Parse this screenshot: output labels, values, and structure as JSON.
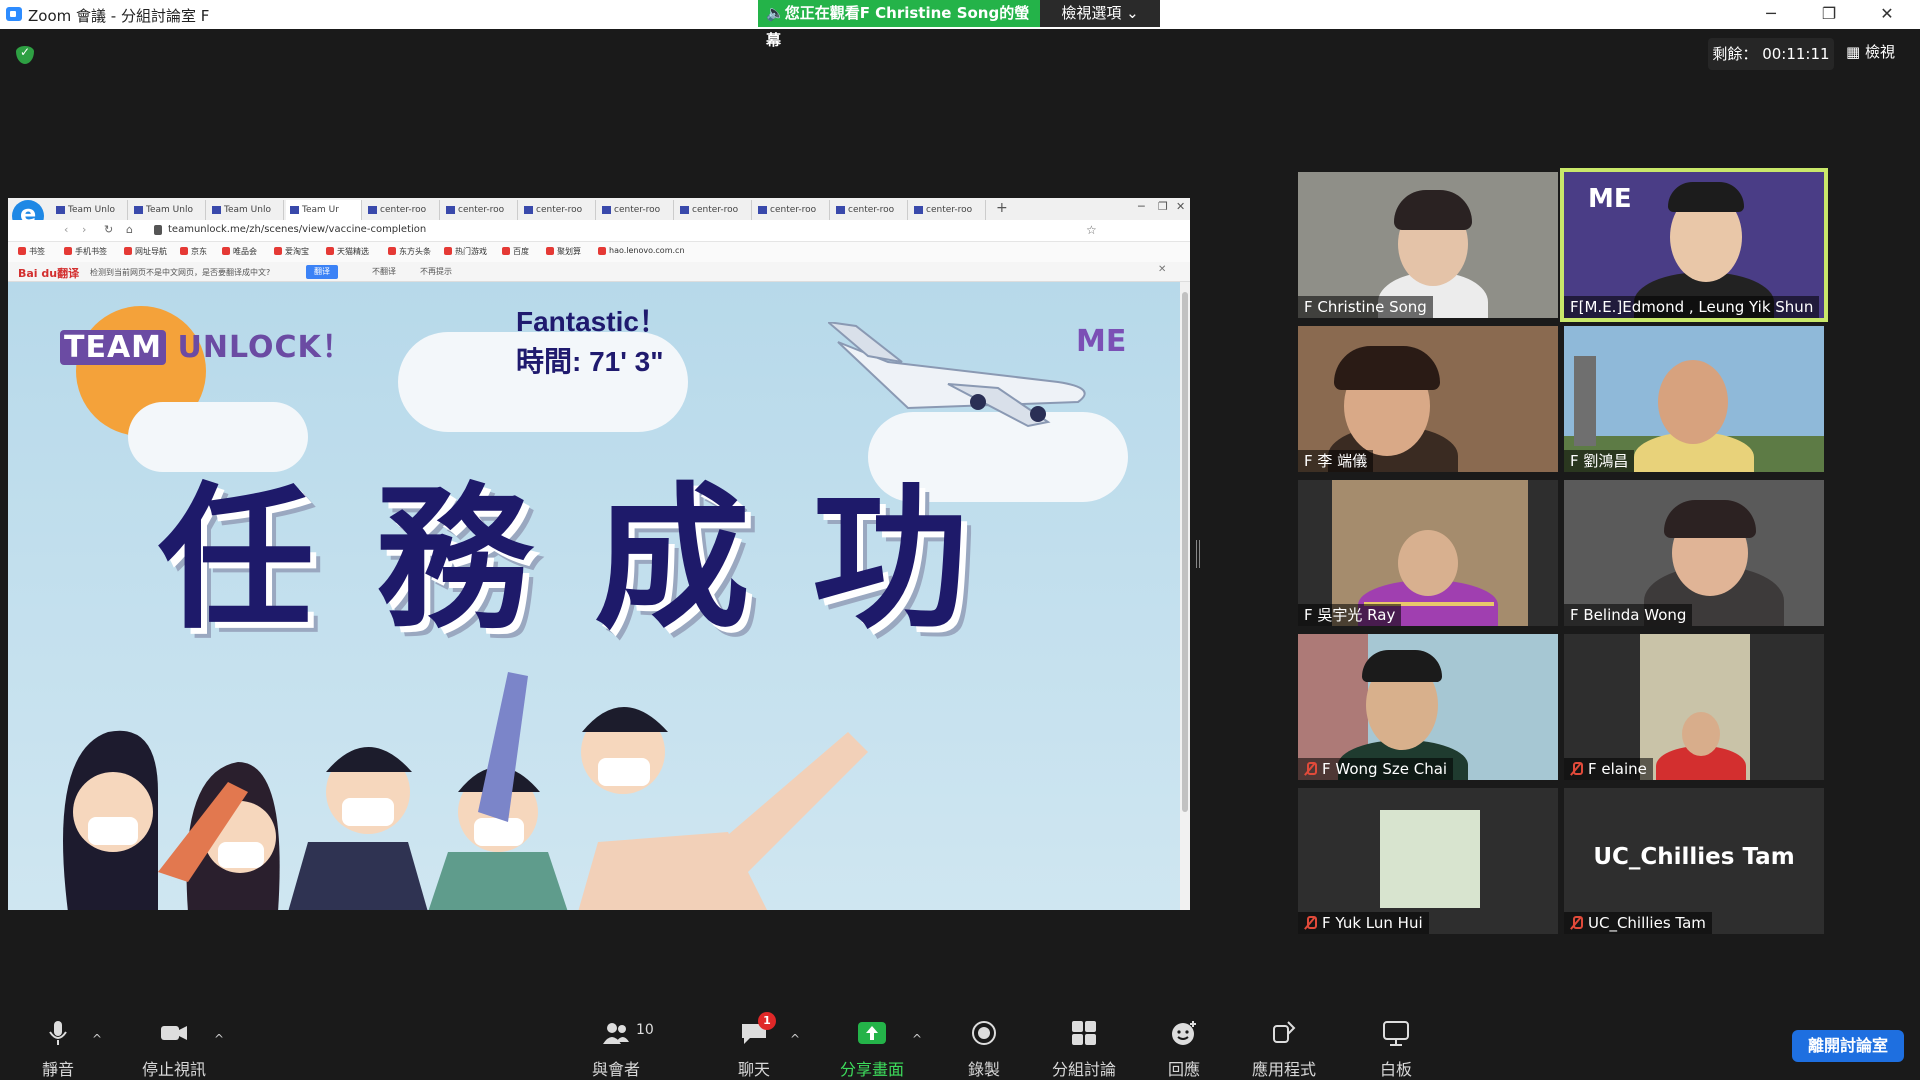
{
  "window": {
    "title": "Zoom 會議 - 分組討論室 F",
    "share_banner": "您正在觀看F  Christine  Song的螢幕",
    "view_options": "檢視選項"
  },
  "top_right": {
    "timer": "剩餘： 00:11:11",
    "view": "檢視"
  },
  "browser": {
    "tabs": [
      "Team Unlo",
      "Team Unlo",
      "Team Unlo",
      "Team Ur",
      "center-roo",
      "center-roo",
      "center-roo",
      "center-roo",
      "center-roo",
      "center-roo",
      "center-roo",
      "center-roo"
    ],
    "url": "teamunlock.me/zh/scenes/view/vaccine-completion",
    "bookmarks": [
      "书签",
      "手机书签",
      "网址导航",
      "京东",
      "唯品会",
      "爱淘宝",
      "天猫精选",
      "东方头条",
      "热门游戏",
      "百度",
      "聚划算",
      "hao.lenovo.com.cn"
    ],
    "translate": {
      "logo": "Bai du翻译",
      "message": "检测到当前网页不是中文网页，是否要翻译成中文?",
      "translate_btn": "翻译",
      "no_btn": "不翻译",
      "never_btn": "不再提示"
    }
  },
  "slide": {
    "logo_white": "TEAM",
    "logo_purple": "UNLOCK！",
    "fantastic": "Fantastic！",
    "time": "時間: 71' 3\"",
    "me_logo": "ME",
    "mission": "任務成功"
  },
  "participants": [
    {
      "name": "F Christine Song",
      "muted": false
    },
    {
      "name": "F[M.E.]Edmond , Leung Yik Shun",
      "muted": false
    },
    {
      "name": "F 李 端儀",
      "muted": false
    },
    {
      "name": "F 劉鴻昌",
      "muted": false
    },
    {
      "name": "F 吳宇光 Ray",
      "muted": false
    },
    {
      "name": "F Belinda Wong",
      "muted": false
    },
    {
      "name": "F Wong Sze Chai",
      "muted": true
    },
    {
      "name": "F elaine",
      "muted": true
    },
    {
      "name": "F Yuk Lun Hui",
      "muted": true
    },
    {
      "name": "UC_Chillies Tam",
      "muted": true,
      "display_name": "UC_Chillies Tam"
    }
  ],
  "toolbar": {
    "mute": "靜音",
    "stop_video": "停止視訊",
    "participants": "與會者",
    "participant_count": "10",
    "chat": "聊天",
    "chat_badge": "1",
    "share": "分享畫面",
    "record": "錄製",
    "breakout": "分組討論",
    "reactions": "回應",
    "apps": "應用程式",
    "whiteboard": "白板",
    "leave": "離開討論室"
  },
  "colors": {
    "share_green": "#24b349",
    "active_speaker": "#c9e86a",
    "leave_blue": "#1e6fe0",
    "slide_navy": "#1e1a6a"
  }
}
